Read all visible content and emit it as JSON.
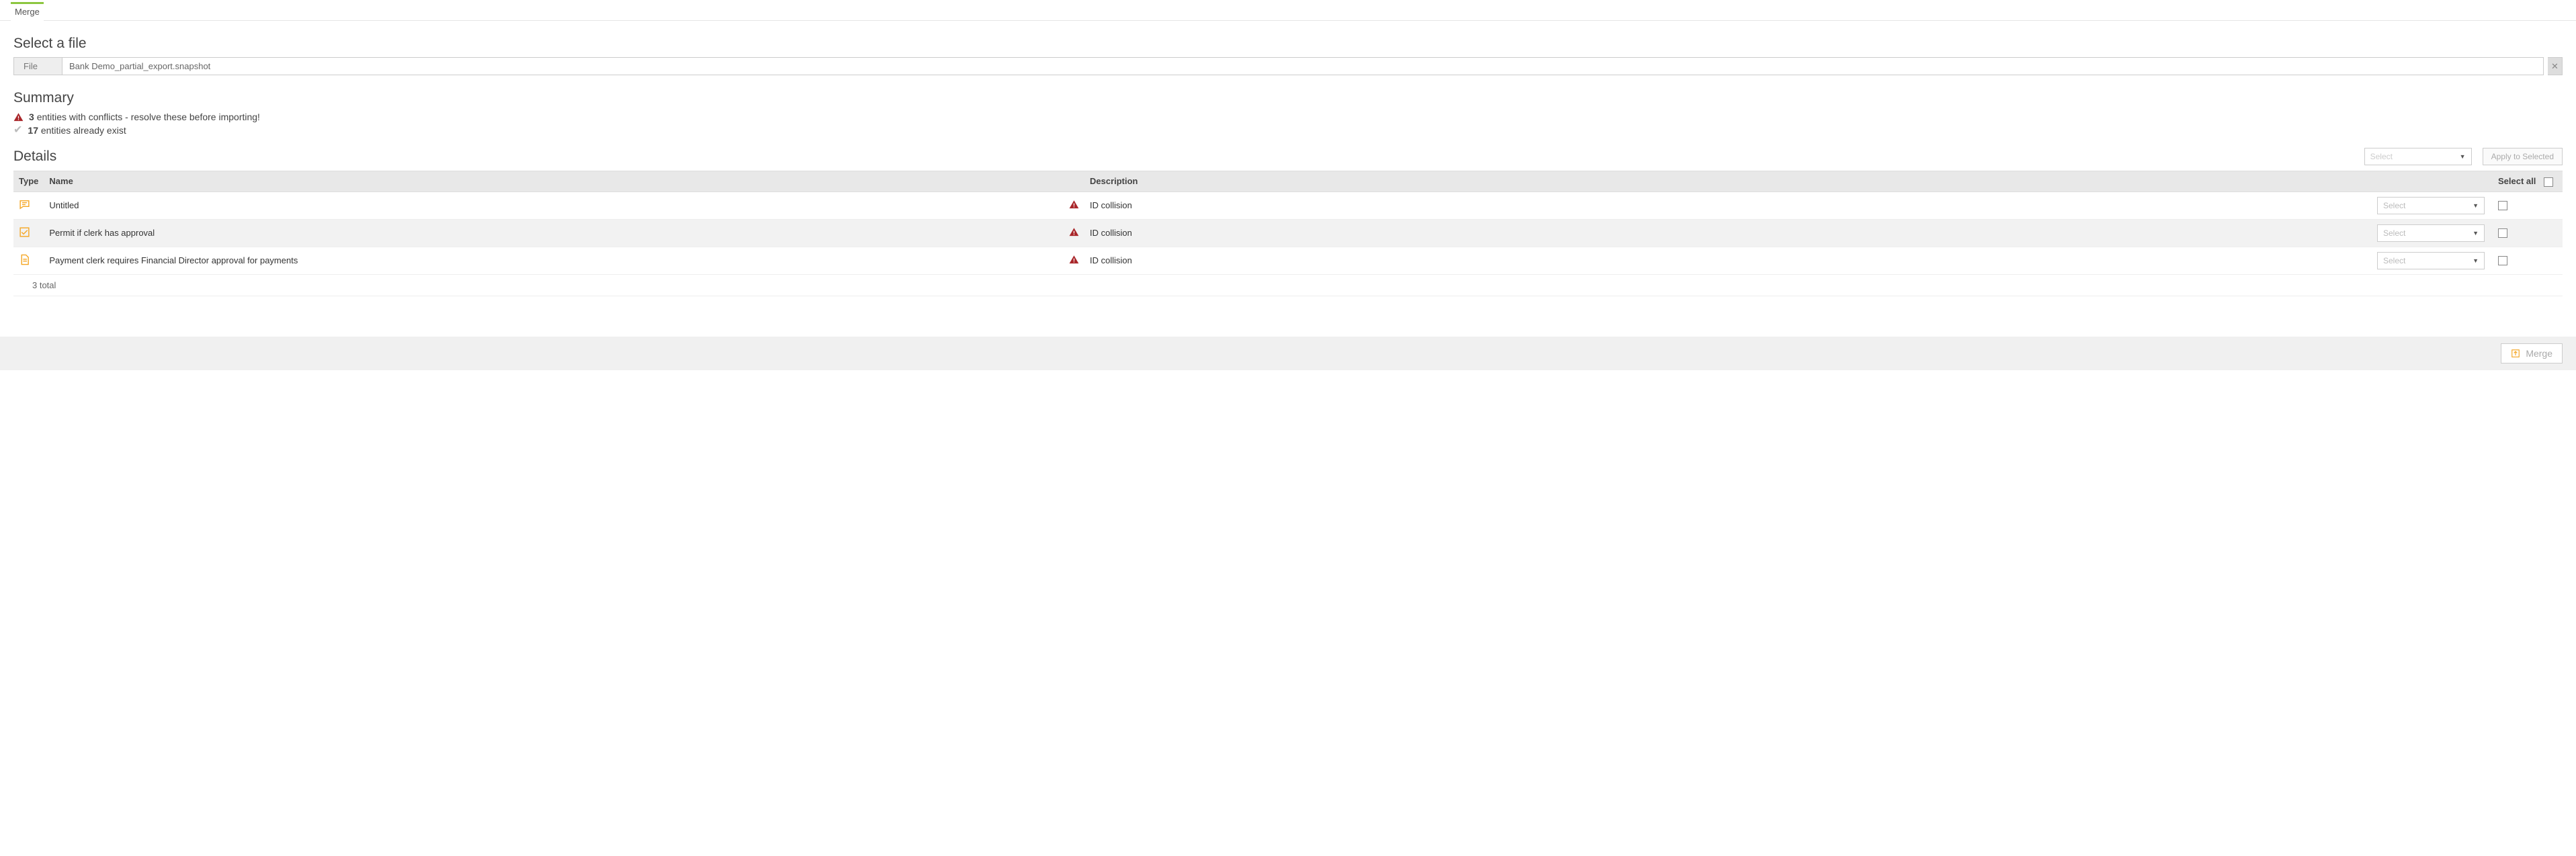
{
  "tabs": {
    "active": "Merge"
  },
  "file_picker": {
    "heading": "Select a file",
    "label": "File",
    "value": "Bank Demo_partial_export.snapshot"
  },
  "summary": {
    "heading": "Summary",
    "conflicts": {
      "count": "3",
      "text": "entities with conflicts - resolve these before importing!"
    },
    "existing": {
      "count": "17",
      "text": "entities already exist"
    }
  },
  "details": {
    "heading": "Details",
    "bulk_select_placeholder": "Select",
    "apply_button": "Apply to Selected",
    "columns": {
      "type": "Type",
      "name": "Name",
      "description": "Description",
      "select_all": "Select all"
    },
    "rows": [
      {
        "icon": "message",
        "name": "Untitled",
        "description": "ID collision",
        "select_placeholder": "Select"
      },
      {
        "icon": "checklist",
        "name": "Permit if clerk has approval",
        "description": "ID collision",
        "select_placeholder": "Select"
      },
      {
        "icon": "document",
        "name": "Payment clerk requires Financial Director approval for payments",
        "description": "ID collision",
        "select_placeholder": "Select"
      }
    ],
    "total_text": "3 total"
  },
  "footer": {
    "merge_button": "Merge"
  },
  "colors": {
    "accent": "#8cc63f",
    "warn": "#a9262a",
    "icon_orange": "#f5a623"
  }
}
